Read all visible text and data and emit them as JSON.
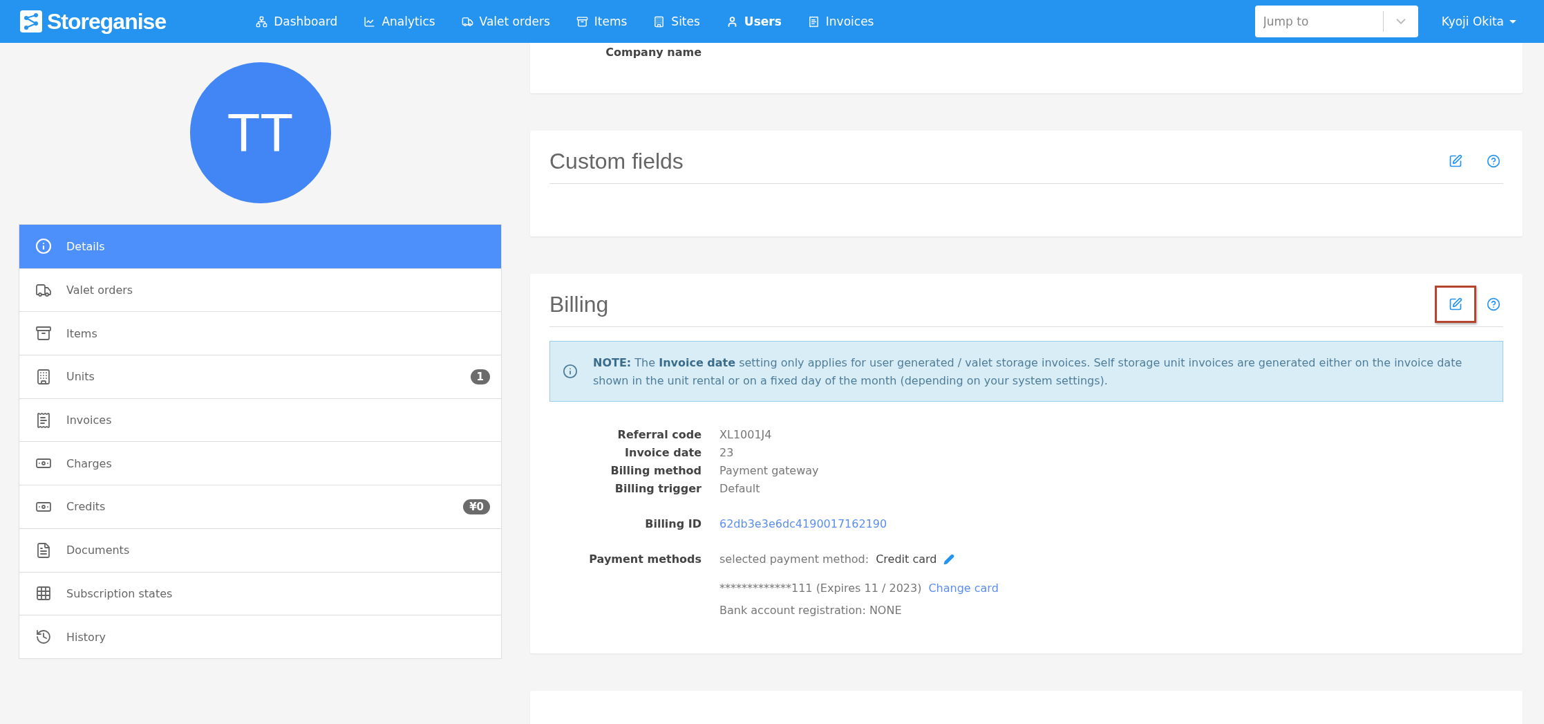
{
  "navbar": {
    "logo": "Storeganise",
    "items": [
      {
        "label": "Dashboard",
        "kind": "sitemap",
        "selected": false
      },
      {
        "label": "Analytics",
        "kind": "chart",
        "selected": false
      },
      {
        "label": "Valet orders",
        "kind": "truck",
        "selected": false
      },
      {
        "label": "Items",
        "kind": "archive",
        "selected": false
      },
      {
        "label": "Sites",
        "kind": "building",
        "selected": false
      },
      {
        "label": "Users",
        "kind": "user",
        "selected": true
      },
      {
        "label": "Invoices",
        "kind": "invoice",
        "selected": false
      }
    ],
    "jump_to": {
      "placeholder": "Jump to"
    },
    "user": "Kyoji Okita"
  },
  "avatar": {
    "initials": "TT"
  },
  "sidebar": {
    "items": [
      {
        "label": "Details",
        "kind": "info",
        "selected": true
      },
      {
        "label": "Valet orders",
        "kind": "truck",
        "selected": false
      },
      {
        "label": "Items",
        "kind": "archive",
        "selected": false
      },
      {
        "label": "Units",
        "kind": "building",
        "selected": false,
        "badge": "1"
      },
      {
        "label": "Invoices",
        "kind": "invoice",
        "selected": false
      },
      {
        "label": "Charges",
        "kind": "money",
        "selected": false
      },
      {
        "label": "Credits",
        "kind": "money",
        "selected": false,
        "badge": "¥0"
      },
      {
        "label": "Documents",
        "kind": "document",
        "selected": false
      },
      {
        "label": "Subscription states",
        "kind": "table",
        "selected": false
      },
      {
        "label": "History",
        "kind": "history",
        "selected": false
      }
    ]
  },
  "company_card": {
    "label": "Company name"
  },
  "custom_fields": {
    "title": "Custom fields",
    "edit_highlighted": false
  },
  "billing": {
    "title": "Billing",
    "edit_highlighted": true,
    "note": "**NOTE:** The **Invoice date** setting only applies for user generated / valet storage invoices. Self storage unit invoices are generated either on the invoice date shown in the unit rental or on a fixed day of the month (depending on your system settings).",
    "fields": [
      {
        "label": "Referral code",
        "value": "XL1001J4"
      },
      {
        "label": "Invoice date",
        "value": "23"
      },
      {
        "label": "Billing method",
        "value": "Payment gateway"
      },
      {
        "label": "Billing trigger",
        "value": "Default"
      }
    ],
    "billing_id": {
      "label": "Billing ID",
      "value": "62db3e3e6dc4190017162190"
    },
    "payment_methods": {
      "label": "Payment methods",
      "selected_text": "selected payment method:",
      "method": "Credit card",
      "card": "*************111 (Expires 11 / 2023)",
      "change_link": "Change card",
      "bank": "Bank account registration: NONE"
    }
  }
}
